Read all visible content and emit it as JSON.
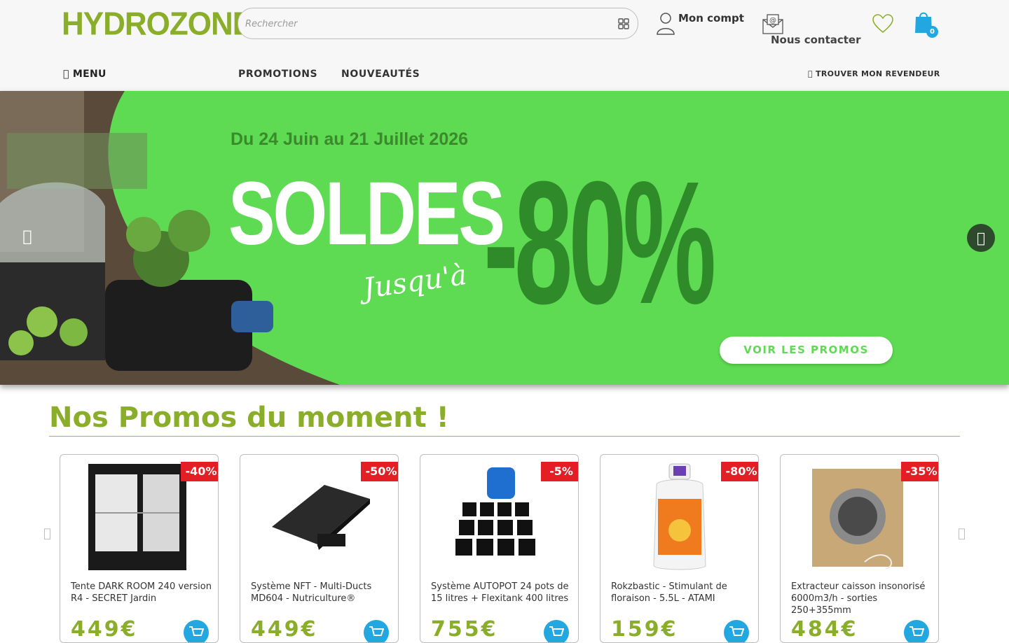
{
  "header": {
    "logo_text": "HYDROZONE",
    "search_placeholder": "Rechercher",
    "account_label": "Mon compt",
    "contact_label": "Nous contacter",
    "cart_count": "0"
  },
  "nav": {
    "menu_icon": "",
    "menu_label": "MENU",
    "links": [
      "PROMOTIONS",
      "NOUVEAUTÉS"
    ],
    "dealer_icon": "",
    "dealer_label": "TROUVER MON REVENDEUR"
  },
  "hero": {
    "date_text": "Du 24 Juin au 21 Juillet 2026",
    "headline": "SOLDES",
    "subtext": "Jusqu'à",
    "discount": "-80%",
    "cta_label": "VOIR LES PROMOS",
    "prev_icon": "",
    "next_icon": ""
  },
  "promos": {
    "title": "Nos Promos du moment !",
    "prev_icon": "",
    "next_icon": "",
    "products": [
      {
        "title": "Tente DARK ROOM 240 version R4 - SECRET Jardin",
        "discount": "-40%",
        "price": "449€"
      },
      {
        "title": "Système NFT - Multi-Ducts MD604 - Nutriculture®",
        "discount": "-50%",
        "price": "449€"
      },
      {
        "title": "Système AUTOPOT 24 pots de 15 litres + Flexitank 400 litres",
        "discount": "-5%",
        "price": "755€"
      },
      {
        "title": "Rokzbastic - Stimulant de floraison - 5.5L - ATAMI",
        "discount": "-80%",
        "price": "159€"
      },
      {
        "title": "Extracteur caisson insonorisé 6000m3/h - sorties 250+355mm",
        "discount": "-35%",
        "price": "484€"
      }
    ]
  },
  "colors": {
    "brand_green": "#8aad2a",
    "hero_green": "#5edb52",
    "badge_red": "#e31e24",
    "cart_blue": "#22a7e0"
  }
}
